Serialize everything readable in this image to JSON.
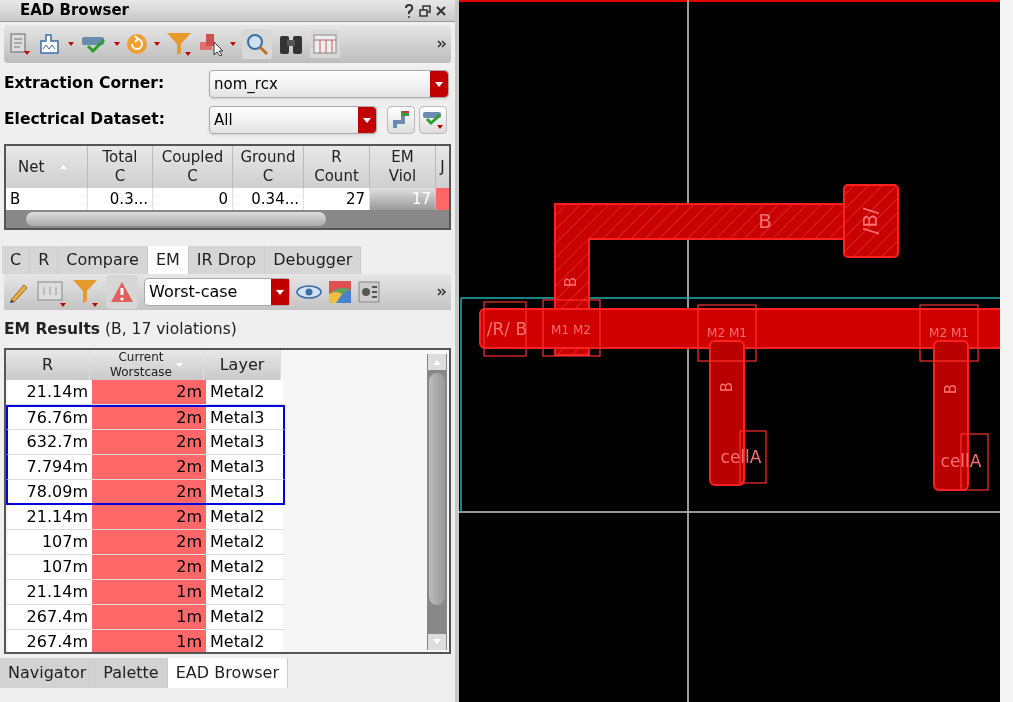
{
  "window": {
    "title": "EAD Browser"
  },
  "extraction_corner": {
    "label": "Extraction Corner:",
    "value": "nom_rcx"
  },
  "electrical_dataset": {
    "label": "Electrical Dataset:",
    "value": "All"
  },
  "net_table": {
    "columns": [
      {
        "lines": [
          "Net"
        ],
        "sorted": true
      },
      {
        "lines": [
          "Total",
          "C"
        ],
        "sorted": false
      },
      {
        "lines": [
          "Coupled",
          "C"
        ],
        "sorted": false
      },
      {
        "lines": [
          "Ground",
          "C"
        ],
        "sorted": false
      },
      {
        "lines": [
          "R",
          "Count"
        ],
        "sorted": false
      },
      {
        "lines": [
          "EM",
          "Viol"
        ],
        "sorted": false
      },
      {
        "lines": [
          "J"
        ],
        "sorted": false
      }
    ],
    "rows": [
      {
        "cells": [
          "B",
          "0.3...",
          "0",
          "0.34...",
          "27",
          "17",
          ""
        ]
      }
    ]
  },
  "tabs": [
    {
      "label": "C",
      "selected": false
    },
    {
      "label": "R",
      "selected": false
    },
    {
      "label": "Compare",
      "selected": false
    },
    {
      "label": "EM",
      "selected": true
    },
    {
      "label": "IR Drop",
      "selected": false
    },
    {
      "label": "Debugger",
      "selected": false
    }
  ],
  "em_mode": {
    "value": "Worst-case"
  },
  "results_heading": "**EM Results** (B, 17 violations)",
  "results_table": {
    "columns": [
      {
        "lines": [
          "R"
        ],
        "sorted": false
      },
      {
        "lines": [
          "Current",
          "Worstcase"
        ],
        "sorted": true
      },
      {
        "lines": [
          "Layer"
        ],
        "sorted": false
      }
    ],
    "rows": [
      {
        "r": "21.14m",
        "current": "2m",
        "layer": "Metal2",
        "selected": false
      },
      {
        "r": "76.76m",
        "current": "2m",
        "layer": "Metal3",
        "selected": true
      },
      {
        "r": "632.7m",
        "current": "2m",
        "layer": "Metal3",
        "selected": true
      },
      {
        "r": "7.794m",
        "current": "2m",
        "layer": "Metal3",
        "selected": true
      },
      {
        "r": "78.09m",
        "current": "2m",
        "layer": "Metal3",
        "selected": true
      },
      {
        "r": "21.14m",
        "current": "2m",
        "layer": "Metal2",
        "selected": false
      },
      {
        "r": "107m",
        "current": "2m",
        "layer": "Metal2",
        "selected": false
      },
      {
        "r": "107m",
        "current": "2m",
        "layer": "Metal2",
        "selected": false
      },
      {
        "r": "21.14m",
        "current": "1m",
        "layer": "Metal2",
        "selected": false
      },
      {
        "r": "267.4m",
        "current": "1m",
        "layer": "Metal2",
        "selected": false
      },
      {
        "r": "267.4m",
        "current": "1m",
        "layer": "Metal2",
        "selected": false
      }
    ]
  },
  "bottom_tabs": [
    {
      "label": "Navigator",
      "selected": false
    },
    {
      "label": "Palette",
      "selected": false
    },
    {
      "label": "EAD Browser",
      "selected": true
    }
  ],
  "layout_labels": {
    "top_wire": "B",
    "top_pin": "/B/",
    "left_pin": "/R/ B",
    "vertical_wire": "B",
    "via_left": "M1 M2",
    "via_middle": "M2 M1",
    "via_right": "M2 M1",
    "leg_middle": "B",
    "leg_right": "B",
    "cell_middle": "cellA",
    "cell_right": "cellA"
  }
}
